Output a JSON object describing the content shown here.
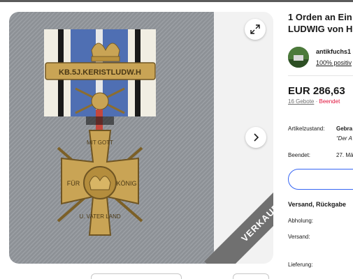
{
  "listing": {
    "title_line1": "1 Orden an Ein",
    "title_line2": "LUDWIG von H",
    "seller": {
      "name": "antikfuchs1 (",
      "feedback": "100% positiv"
    },
    "price": "EUR 286,63",
    "bids": "16 Gebote",
    "bids_sep": " · ",
    "status": "Beendet",
    "condition": {
      "label": "Artikelzustand:",
      "value": "Gebra",
      "note": "“Der A"
    },
    "ended": {
      "label": "Beendet:",
      "value": "27. Mä"
    },
    "shipping_heading": "Versand, Rückgabe",
    "pickup_label": "Abholung:",
    "shipping_label": "Versand:",
    "delivery_label": "Lieferung:"
  },
  "gallery": {
    "sold_ribbon": "VERKAUFT",
    "expand_icon": "expand-icon",
    "next_icon": "chevron-right-icon",
    "medal_bar_text": "KB.5J.KERISTLUDW.H",
    "cross_top": "MIT GOTT",
    "cross_left": "FÜR",
    "cross_right": "KÖNIG",
    "cross_bottom": "U. VATER LAND"
  },
  "colors": {
    "accent": "#3665f3",
    "ended": "#e0103a",
    "ribbon": "#707070",
    "brass": "#c9a455"
  }
}
